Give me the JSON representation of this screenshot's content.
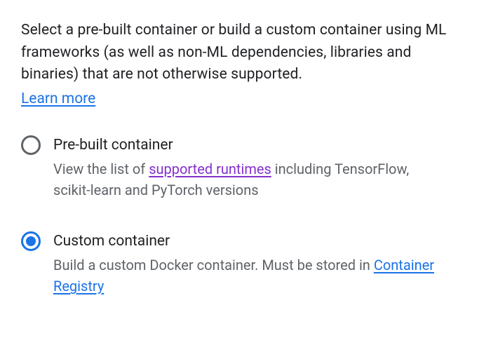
{
  "intro": {
    "text": "Select a pre-built container or build a custom container using ML frameworks (as well as non-ML dependencies, libraries and binaries) that are not otherwise supported.",
    "learn_more": "Learn more"
  },
  "options": {
    "prebuilt": {
      "title": "Pre-built container",
      "desc_before": "View the list of ",
      "link": "supported runtimes",
      "desc_after": " including TensorFlow, scikit-learn and PyTorch versions",
      "selected": false
    },
    "custom": {
      "title": "Custom container",
      "desc_before": "Build a custom Docker container. Must be stored in ",
      "link": "Container Registry",
      "selected": true
    }
  }
}
